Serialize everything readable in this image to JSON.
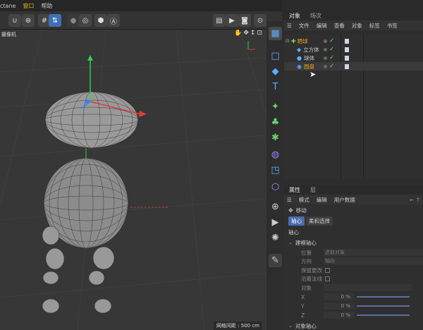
{
  "menubar": {
    "items": [
      "ctane",
      "窗口",
      "帮助"
    ]
  },
  "toolbar": {
    "buttons": [
      "magnet-icon",
      "snap-icon",
      "grid-icon",
      "align-icon",
      "record-icon",
      "target-icon",
      "hex-icon",
      "auto-icon",
      "clapper-icon",
      "render-settings-icon",
      "render-icon",
      "picture-viewer-icon"
    ]
  },
  "viewport": {
    "camera_label": "摄像机",
    "grid_spacing": "网格间距 : 500 cm"
  },
  "object_manager": {
    "tabs": [
      "对象",
      "场次"
    ],
    "menu": [
      "文件",
      "编辑",
      "查看",
      "对象",
      "标签",
      "书签"
    ],
    "objects": [
      {
        "name": "晒球",
        "color": "#e6a020",
        "icon": "null-group-icon"
      },
      {
        "name": "立方体",
        "color": "#c8c8c8",
        "icon": "cube-object-icon"
      },
      {
        "name": "球体",
        "color": "#c8c8c8",
        "icon": "sphere-object-icon"
      },
      {
        "name": "圆盘",
        "color": "#e6a020",
        "icon": "disc-object-icon"
      }
    ]
  },
  "attributes": {
    "tabs": [
      "属性",
      "层"
    ],
    "menu": [
      "模式",
      "编辑",
      "用户数据"
    ],
    "tool_name": "移动",
    "subtabs": [
      "轴心",
      "柔和选择"
    ],
    "section_title": "轴心",
    "group_title": "建模轴心",
    "fields": [
      {
        "label": "位置",
        "value": "选取对象"
      },
      {
        "label": "方向",
        "value": "轴向"
      }
    ],
    "checks": [
      "保留更改",
      "沿着法线"
    ],
    "object_label": "对象",
    "coords": [
      {
        "label": "X",
        "value": "0 %"
      },
      {
        "label": "Y",
        "value": "0 %"
      },
      {
        "label": "Z",
        "value": "0 %"
      }
    ],
    "group2_title": "对象轴心"
  }
}
